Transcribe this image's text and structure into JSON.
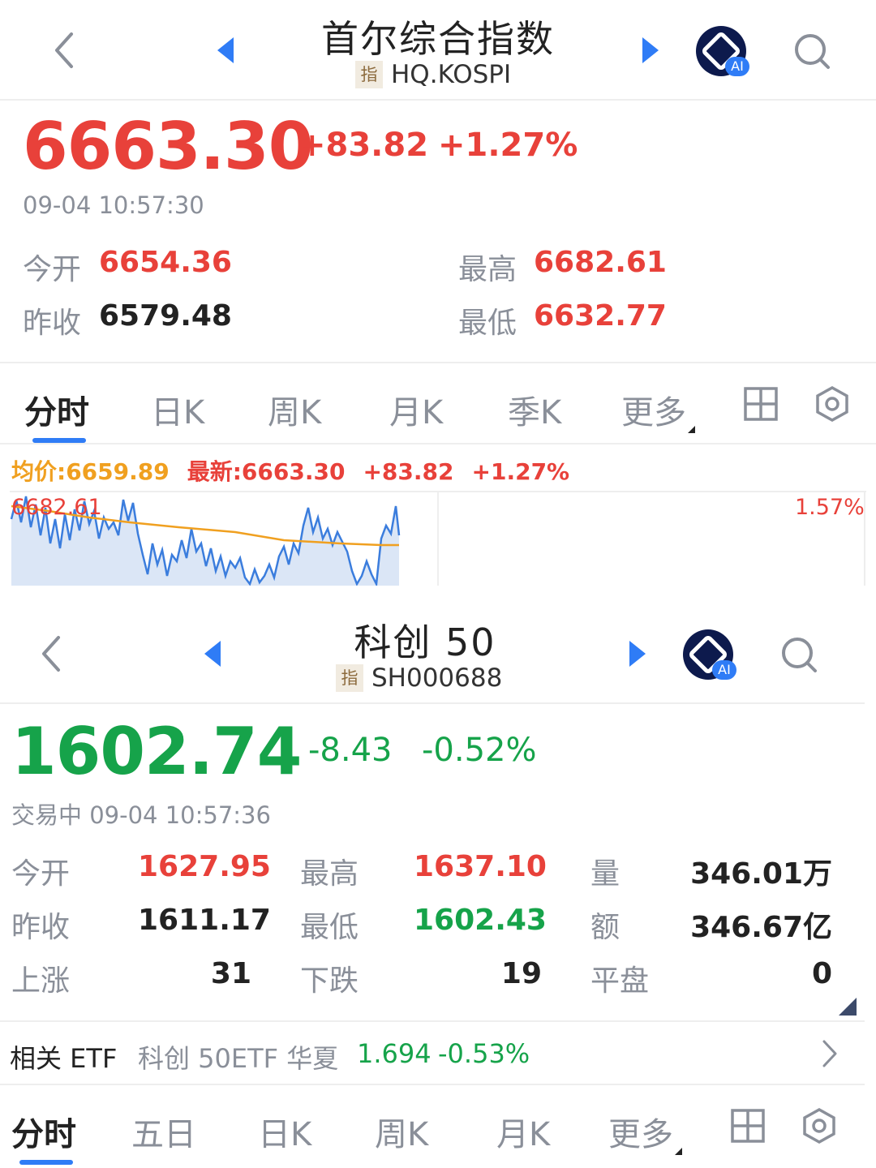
{
  "kospi": {
    "title": "首尔综合指数",
    "badge": "指",
    "code": "HQ.KOSPI",
    "ai_label": "AI",
    "price": "6663.30",
    "change": "+83.82",
    "change_pct": "+1.27%",
    "timestamp": "09-04 10:57:30",
    "open_label": "今开",
    "open": "6654.36",
    "high_label": "最高",
    "high": "6682.61",
    "prev_close_label": "昨收",
    "prev_close": "6579.48",
    "low_label": "最低",
    "low": "6632.77",
    "tabs": [
      "分时",
      "日K",
      "周K",
      "月K",
      "季K",
      "更多"
    ],
    "legend": {
      "avg": "均价:6659.89",
      "latest": "最新:6663.30",
      "change": "+83.82",
      "change_pct": "+1.27%"
    },
    "chart_high_label": "6682.61",
    "chart_pct_label": "1.57%"
  },
  "kcb50": {
    "title": "科创 50",
    "badge": "指",
    "code": "SH000688",
    "ai_label": "AI",
    "price": "1602.74",
    "change": "-8.43",
    "change_pct": "-0.52%",
    "timestamp": "交易中 09-04 10:57:36",
    "stats": {
      "open_label": "今开",
      "open": "1627.95",
      "high_label": "最高",
      "high": "1637.10",
      "volume_label": "量",
      "volume": "346.01万",
      "prev_close_label": "昨收",
      "prev_close": "1611.17",
      "low_label": "最低",
      "low": "1602.43",
      "amount_label": "额",
      "amount": "346.67亿",
      "up_label": "上涨",
      "up": "31",
      "down_label": "下跌",
      "down": "19",
      "flat_label": "平盘",
      "flat": "0"
    },
    "etf": {
      "label": "相关 ETF",
      "name": "科创 50ETF 华夏",
      "price": "1.694",
      "change_pct": "-0.53%"
    },
    "tabs": [
      "分时",
      "五日",
      "日K",
      "周K",
      "月K",
      "更多"
    ]
  },
  "colors": {
    "up": "#e8413a",
    "down": "#16a34a",
    "accent": "#2f7cf6",
    "avg_line": "#f0a020",
    "price_line": "#3b7ddd"
  },
  "icons": [
    "back-arrow-icon",
    "prev-triangle-icon",
    "next-triangle-icon",
    "ai-assistant-icon",
    "search-icon",
    "grid-layout-icon",
    "settings-hex-icon",
    "chevron-right-icon"
  ]
}
